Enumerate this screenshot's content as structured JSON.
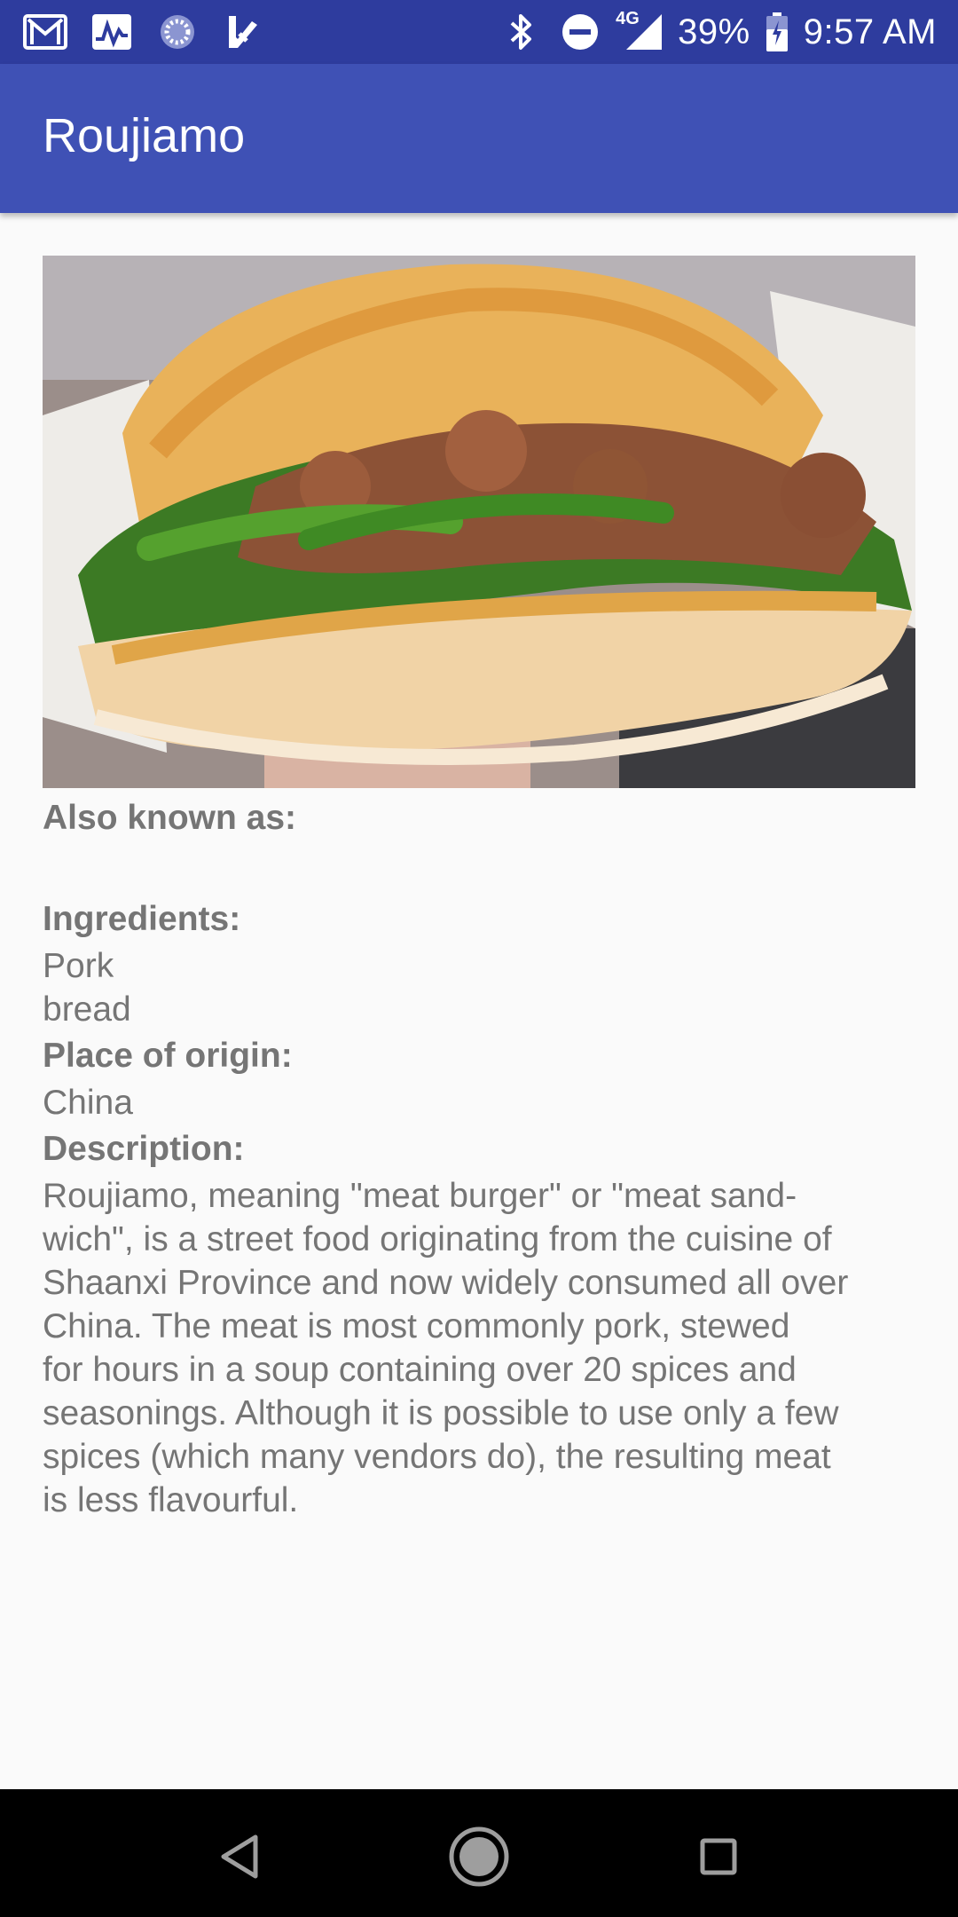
{
  "status_bar": {
    "notification_icons": [
      "gmail-icon",
      "activity-chart-icon",
      "loading-spinner-icon",
      "task-check-icon"
    ],
    "system_icons": [
      "bluetooth-icon",
      "do-not-disturb-icon",
      "signal-4g-icon",
      "battery-icon"
    ],
    "network_label": "4G",
    "battery": "39%",
    "time": "9:57 AM"
  },
  "app_bar": {
    "title": "Roujiamo"
  },
  "detail": {
    "image_alt": "Roujiamo",
    "also_known_as_label": "Also known as:",
    "also_known_as_value": "",
    "ingredients_label": "Ingredients:",
    "ingredients": [
      "Pork",
      "bread"
    ],
    "place_of_origin_label": "Place of origin:",
    "place_of_origin_value": "China",
    "description_label": "Description:",
    "description_lines": [
      "Roujiamo, meaning \"meat burger\" or \"meat sand-",
      "wich\", is a street food originating from the cuisine of",
      "Shaanxi Province and now widely consumed all over",
      "China. The meat is most commonly pork, stewed",
      "for hours in a soup containing over 20 spices and",
      "seasonings. Although it is possible to use only a few",
      "spices (which many vendors do), the resulting meat",
      "is less flavourful."
    ]
  },
  "nav_bar": {
    "buttons": [
      "back-icon",
      "home-icon",
      "recents-icon"
    ]
  },
  "colors": {
    "status_bar": "#2E3C9E",
    "app_bar": "#3F51B5",
    "text": "#757575",
    "background": "#FAFAFA"
  }
}
